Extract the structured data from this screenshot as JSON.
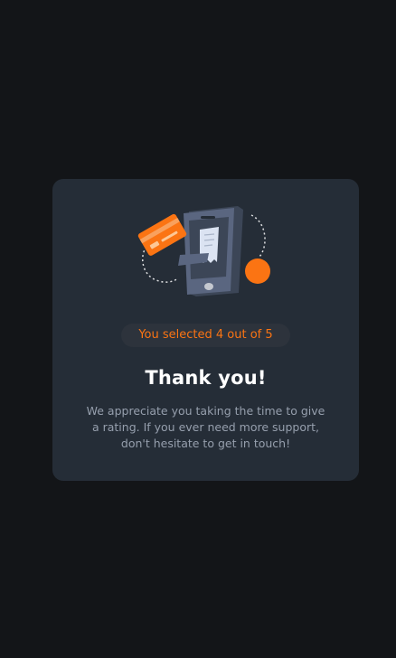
{
  "rating": {
    "selected": 4,
    "max": 5,
    "badge_text": "You selected 4 out of 5"
  },
  "thank_you": {
    "title": "Thank you!",
    "message": "We appreciate you taking the time to give a rating. If you ever need more support, don't hesitate to get in touch!"
  },
  "illustration": {
    "icon": "payment-phone-illustration"
  },
  "colors": {
    "page_background": "#131518",
    "card_background": "#252d37",
    "badge_background": "#2d333c",
    "accent": "#fb7413",
    "title": "#ffffff",
    "body_text": "#969fad"
  }
}
